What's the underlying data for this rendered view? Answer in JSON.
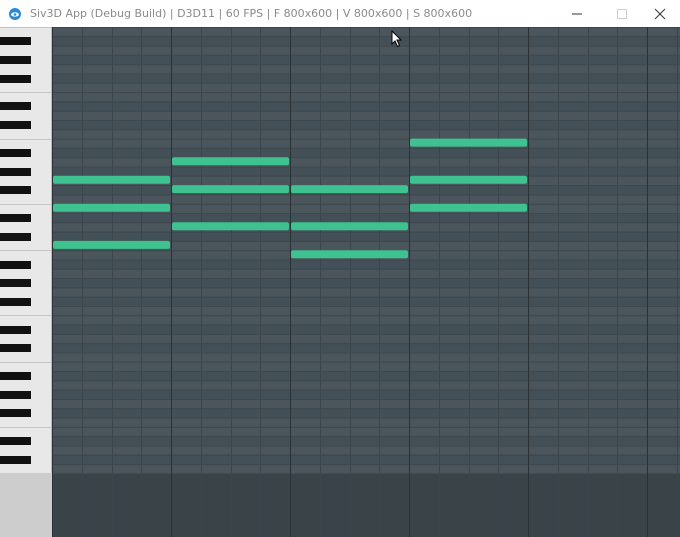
{
  "window": {
    "title": "Siv3D App (Debug Build) | D3D11 | 60 FPS | F 800x600 | V 800x600 | S 800x600",
    "icon": "siv3d-app-icon",
    "controls": [
      "minimize-icon",
      "maximize-icon",
      "close-icon"
    ]
  },
  "colors": {
    "roll_background": "#4a555c",
    "roll_row_dark": "#435057",
    "roll_lower_area": "#3a4348",
    "note": "#3ec28f",
    "piano_white": "#e8e8e8",
    "piano_black": "#111111"
  },
  "piano_roll": {
    "visible_rows": 48,
    "beats_per_bar": 4,
    "bars_visible": 5,
    "notes": [
      {
        "bar": 1,
        "row": 16,
        "length_bars": 1
      },
      {
        "bar": 1,
        "row": 19,
        "length_bars": 1
      },
      {
        "bar": 1,
        "row": 23,
        "length_bars": 1
      },
      {
        "bar": 2,
        "row": 14,
        "length_bars": 1
      },
      {
        "bar": 2,
        "row": 17,
        "length_bars": 1
      },
      {
        "bar": 2,
        "row": 21,
        "length_bars": 1
      },
      {
        "bar": 3,
        "row": 17,
        "length_bars": 1
      },
      {
        "bar": 3,
        "row": 21,
        "length_bars": 1
      },
      {
        "bar": 3,
        "row": 24,
        "length_bars": 1
      },
      {
        "bar": 4,
        "row": 12,
        "length_bars": 1
      },
      {
        "bar": 4,
        "row": 16,
        "length_bars": 1
      },
      {
        "bar": 4,
        "row": 19,
        "length_bars": 1
      }
    ]
  }
}
